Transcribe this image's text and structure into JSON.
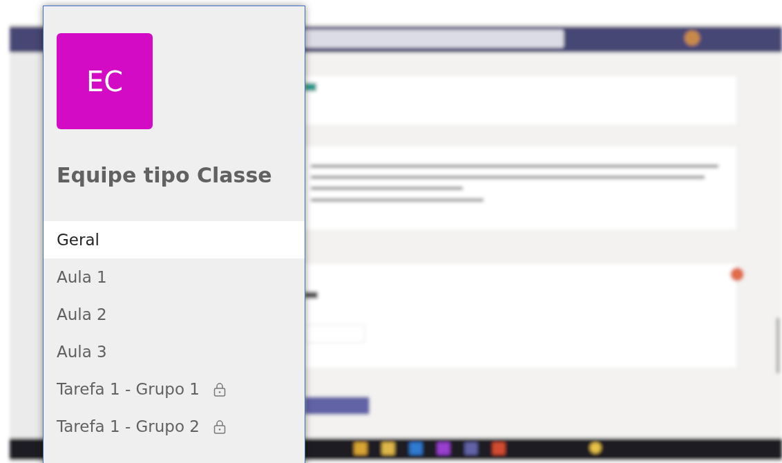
{
  "team": {
    "initials": "EC",
    "name": "Equipe tipo Classe"
  },
  "channels": [
    {
      "label": "Geral",
      "selected": true,
      "locked": false
    },
    {
      "label": "Aula 1",
      "selected": false,
      "locked": false
    },
    {
      "label": "Aula 2",
      "selected": false,
      "locked": false
    },
    {
      "label": "Aula 3",
      "selected": false,
      "locked": false
    },
    {
      "label": "Tarefa 1 - Grupo 1",
      "selected": false,
      "locked": true
    },
    {
      "label": "Tarefa 1 - Grupo 2",
      "selected": false,
      "locked": true
    }
  ]
}
